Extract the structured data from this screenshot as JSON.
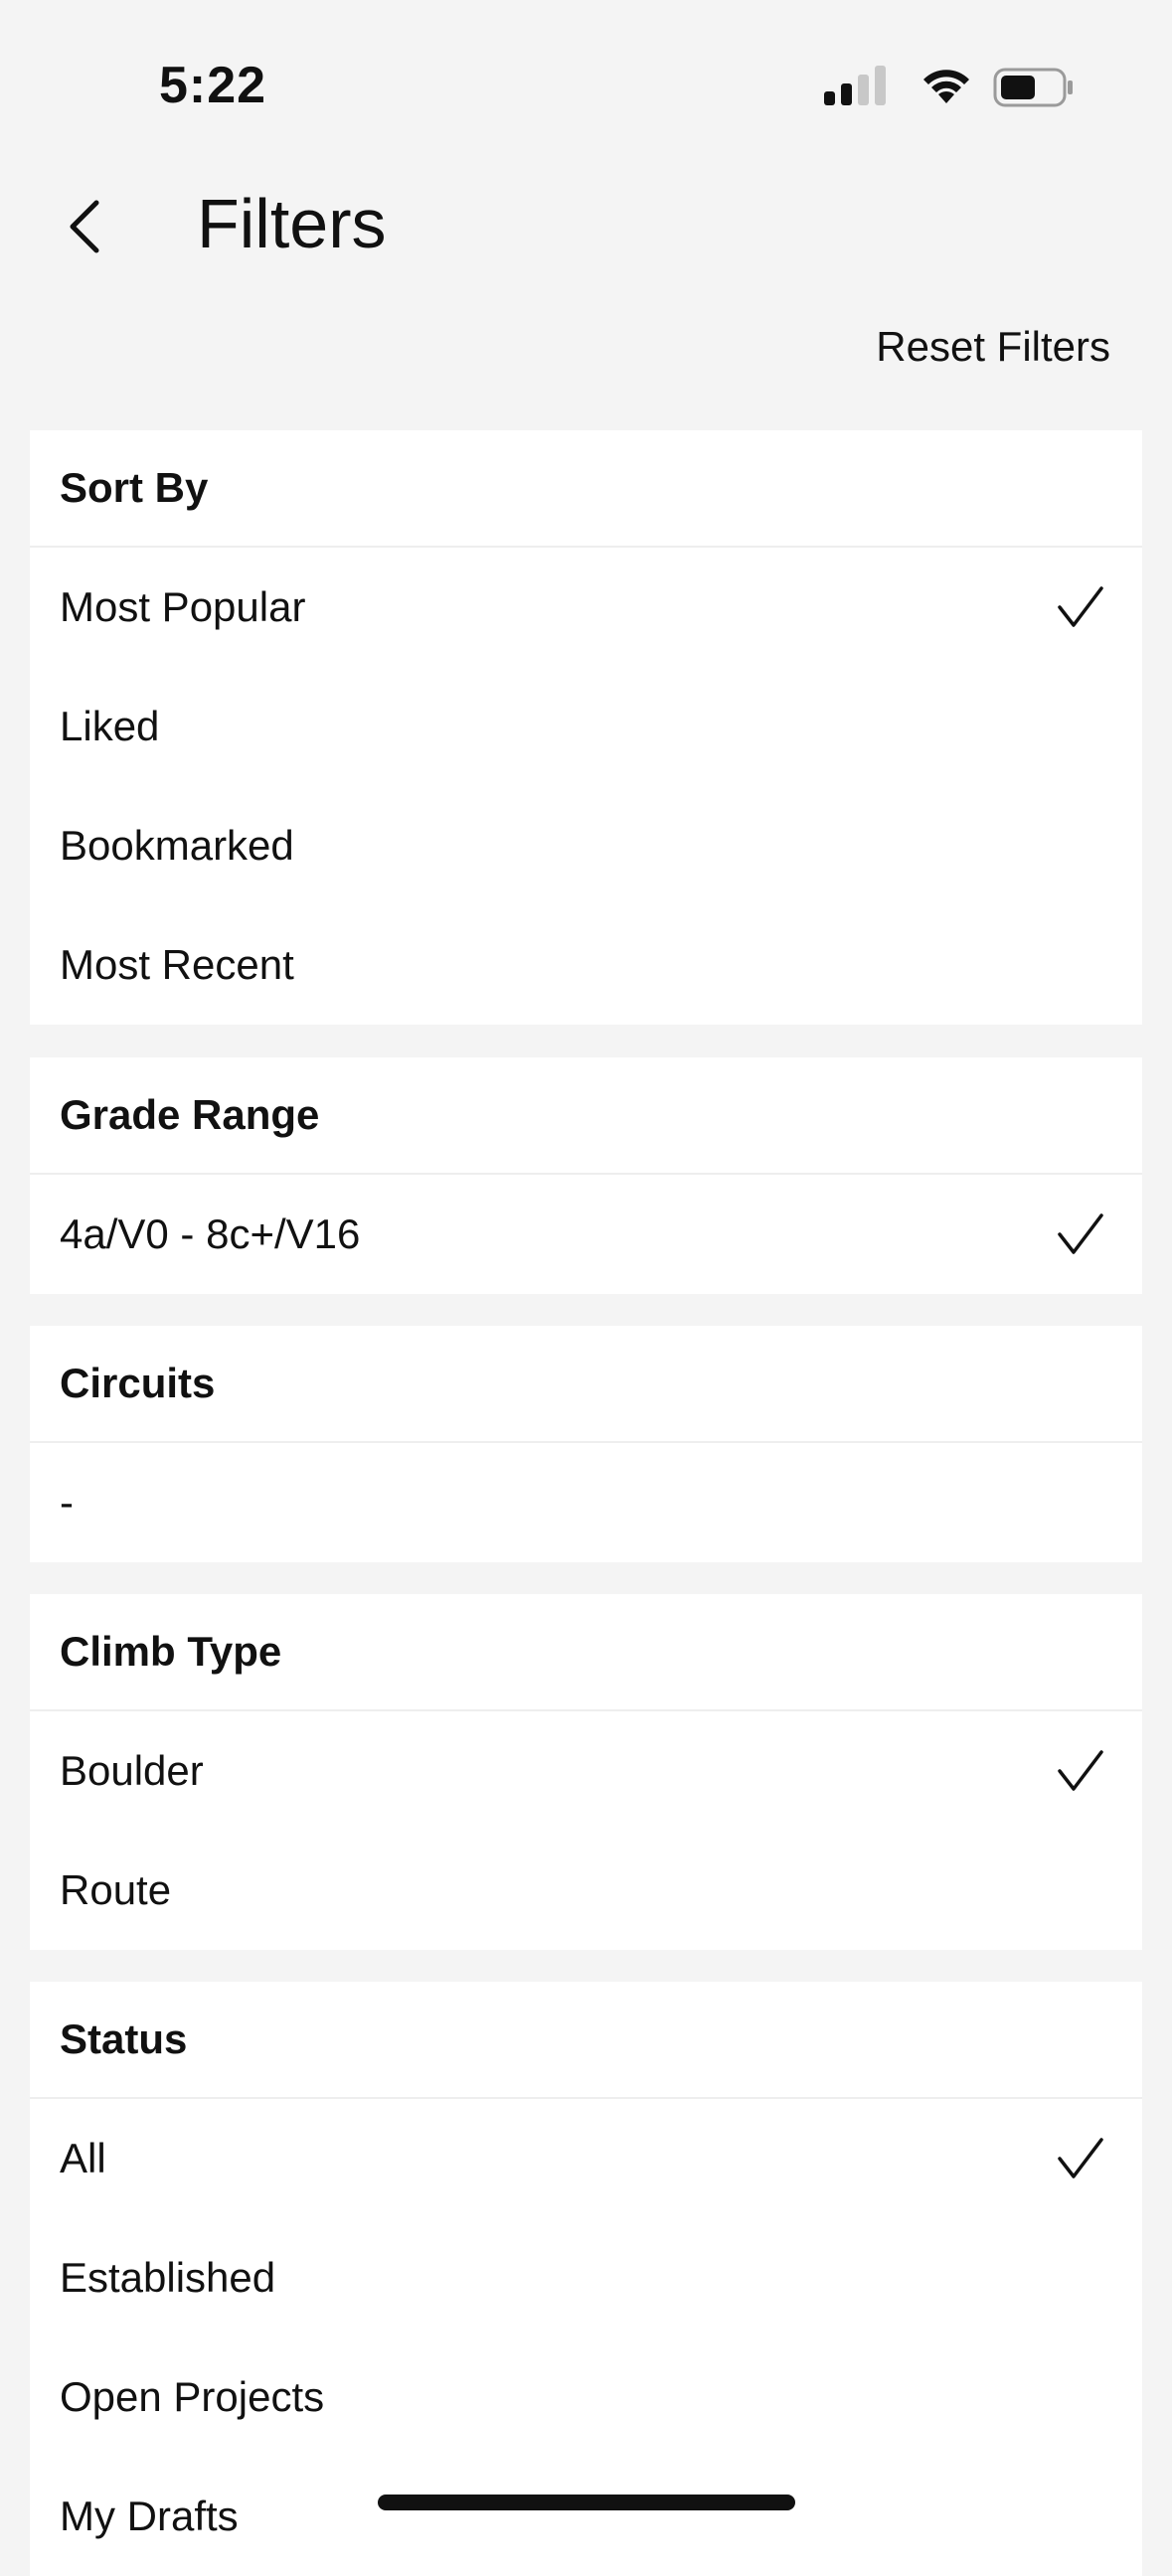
{
  "status_bar": {
    "time": "5:22"
  },
  "nav": {
    "title": "Filters",
    "reset_label": "Reset Filters",
    "back_icon": "chevron-left-icon"
  },
  "sections": {
    "sort_by": {
      "title": "Sort By",
      "options": [
        {
          "label": "Most Popular",
          "checked": true
        },
        {
          "label": "Liked",
          "checked": false
        },
        {
          "label": "Bookmarked",
          "checked": false
        },
        {
          "label": "Most Recent",
          "checked": false
        }
      ]
    },
    "grade_range": {
      "title": "Grade Range",
      "options": [
        {
          "label": "4a/V0 - 8c+/V16",
          "checked": true
        }
      ]
    },
    "circuits": {
      "title": "Circuits",
      "options": [
        {
          "label": "-",
          "checked": false
        }
      ]
    },
    "climb_type": {
      "title": "Climb Type",
      "options": [
        {
          "label": "Boulder",
          "checked": true
        },
        {
          "label": "Route",
          "checked": false
        }
      ]
    },
    "status": {
      "title": "Status",
      "options": [
        {
          "label": "All",
          "checked": true
        },
        {
          "label": "Established",
          "checked": false
        },
        {
          "label": "Open Projects",
          "checked": false
        },
        {
          "label": "My Drafts",
          "checked": false
        }
      ]
    }
  },
  "colors": {
    "background": "#f4f4f4",
    "card": "#ffffff",
    "text": "#111111"
  }
}
